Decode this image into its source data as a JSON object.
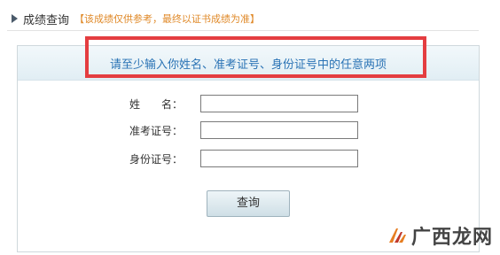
{
  "header": {
    "title": "成绩查询",
    "note": "【该成绩仅供参考，最终以证书成绩为准】"
  },
  "panel": {
    "heading": "请至少输入你姓名、准考证号、身份证号中的任意两项"
  },
  "form": {
    "name_label": "姓　　名：",
    "exam_no_label": "准考证号：",
    "id_no_label": "身份证号：",
    "name_value": "",
    "exam_no_value": "",
    "id_no_value": "",
    "submit_label": "查询"
  },
  "watermark": {
    "text": "广西龙网"
  },
  "colors": {
    "accent_blue": "#2a73b5",
    "note_orange": "#e08a2a",
    "highlight_red": "#e43d40"
  }
}
